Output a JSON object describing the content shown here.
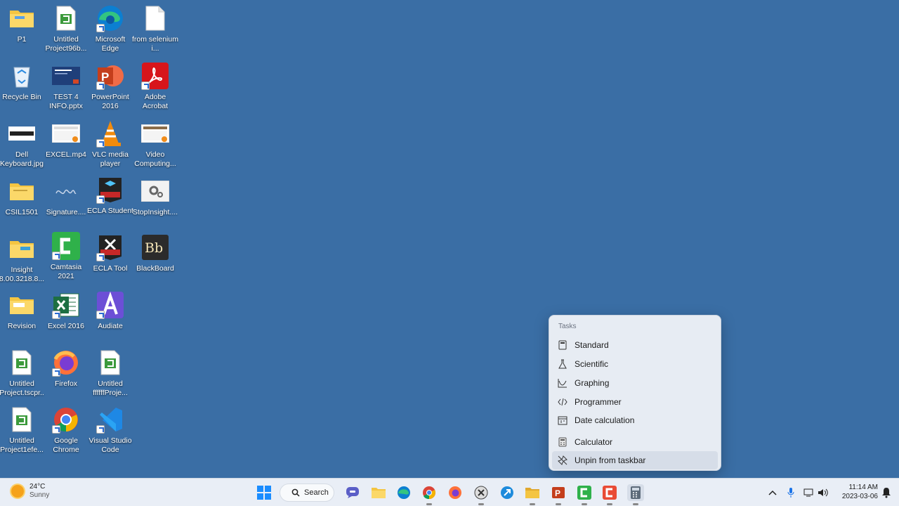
{
  "desktop": {
    "icons": [
      {
        "label": "P1",
        "icon": "folder-icon"
      },
      {
        "label": "Untitled Project96b...",
        "icon": "camtasia-project-icon"
      },
      {
        "label": "Microsoft Edge",
        "icon": "edge-icon"
      },
      {
        "label": "from selenium i...",
        "icon": "document-icon"
      },
      {
        "label": "Recycle Bin",
        "icon": "recycle-bin-icon"
      },
      {
        "label": "TEST 4 INFO.pptx",
        "icon": "pptx-thumbnail-icon"
      },
      {
        "label": "PowerPoint 2016",
        "icon": "powerpoint-icon"
      },
      {
        "label": "Adobe Acrobat",
        "icon": "acrobat-icon"
      },
      {
        "label": "Dell Keyboard.jpg",
        "icon": "keyboard-image-icon"
      },
      {
        "label": "EXCEL.mp4",
        "icon": "video-file-icon"
      },
      {
        "label": "VLC media player",
        "icon": "vlc-icon"
      },
      {
        "label": "Video Computing...",
        "icon": "video-file-icon"
      },
      {
        "label": "CSIL1501",
        "icon": "folder-icon"
      },
      {
        "label": "Signature....",
        "icon": "signature-image-icon"
      },
      {
        "label": "ECLA Student",
        "icon": "ecla-student-icon"
      },
      {
        "label": "StopInsight....",
        "icon": "settings-file-icon"
      },
      {
        "label": "Insight 8.00.3218.8...",
        "icon": "folder-icon"
      },
      {
        "label": "Camtasia 2021",
        "icon": "camtasia-icon"
      },
      {
        "label": "ECLA Tool",
        "icon": "ecla-tool-icon"
      },
      {
        "label": "BlackBoard",
        "icon": "blackboard-icon"
      },
      {
        "label": "Revision",
        "icon": "folder-icon"
      },
      {
        "label": "Excel 2016",
        "icon": "excel-icon"
      },
      {
        "label": "Audiate",
        "icon": "audiate-icon"
      },
      {
        "label": "Untitled Project.tscpr...",
        "icon": "camtasia-project-icon"
      },
      {
        "label": "Firefox",
        "icon": "firefox-icon"
      },
      {
        "label": "Untitled ffffffProje...",
        "icon": "camtasia-project-icon"
      },
      {
        "label": "Untitled Project1efe...",
        "icon": "camtasia-project-icon"
      },
      {
        "label": "Google Chrome",
        "icon": "chrome-icon"
      },
      {
        "label": "Visual Studio Code",
        "icon": "vscode-icon"
      }
    ]
  },
  "jumplist": {
    "heading": "Tasks",
    "items": [
      {
        "label": "Standard",
        "icon": "standard-calculator-icon"
      },
      {
        "label": "Scientific",
        "icon": "flask-icon"
      },
      {
        "label": "Graphing",
        "icon": "graph-icon"
      },
      {
        "label": "Programmer",
        "icon": "code-icon"
      },
      {
        "label": "Date calculation",
        "icon": "calendar-icon"
      }
    ],
    "app_item": {
      "label": "Calculator",
      "icon": "calculator-icon"
    },
    "unpin_item": {
      "label": "Unpin from taskbar",
      "icon": "unpin-icon"
    }
  },
  "taskbar": {
    "weather": {
      "temp": "24°C",
      "condition": "Sunny"
    },
    "search_label": "Search",
    "clock": {
      "time": "11:14 AM",
      "date": "2023-03-06"
    }
  },
  "colors": {
    "desktop": "#3a6ea5",
    "taskbar": "#e9eef6",
    "jumplist": "#e7ecf3"
  }
}
